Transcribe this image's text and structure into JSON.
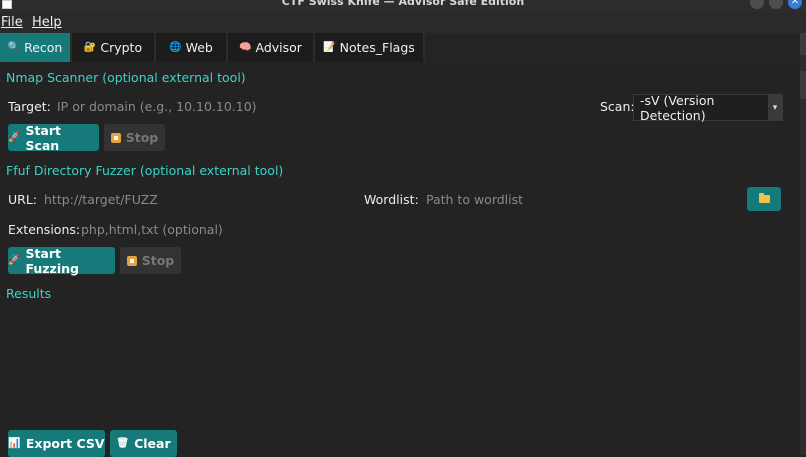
{
  "window": {
    "title": "CTF Swiss Knife — Advisor Safe Edition",
    "close_glyph": "✕"
  },
  "menu": [
    {
      "label": "File"
    },
    {
      "label": "Help"
    }
  ],
  "tabs": [
    {
      "label": "Recon",
      "icon": "🔍",
      "icon_name": "magnifier-icon",
      "active": true
    },
    {
      "label": "Crypto",
      "icon": "🔐",
      "icon_name": "lock-icon"
    },
    {
      "label": "Web",
      "icon": "🌐",
      "icon_name": "globe-icon"
    },
    {
      "label": "Advisor",
      "icon": "🧠",
      "icon_name": "brain-icon"
    },
    {
      "label": "Notes_Flags",
      "icon": "📝",
      "icon_name": "memo-icon"
    }
  ],
  "nmap": {
    "heading": "Nmap Scanner (optional external tool)",
    "target_label": "Target:",
    "target_placeholder": "IP or domain (e.g., 10.10.10.10)",
    "scan_label": "Scan:",
    "scan_value": "-sV (Version Detection)",
    "start_label": "Start Scan",
    "stop_label": "Stop"
  },
  "ffuf": {
    "heading": "Ffuf Directory Fuzzer (optional external tool)",
    "url_label": "URL:",
    "url_placeholder": "http://target/FUZZ",
    "wordlist_label": "Wordlist:",
    "wordlist_placeholder": "Path to wordlist",
    "extensions_label": "Extensions:",
    "extensions_placeholder": "php,html,txt (optional)",
    "start_label": "Start Fuzzing",
    "stop_label": "Stop"
  },
  "results": {
    "heading": "Results",
    "export_label": "Export CSV",
    "clear_label": "Clear"
  },
  "icons": {
    "rocket": "🚀",
    "chart": "📊",
    "trash": "🗑"
  },
  "colors": {
    "accent": "#167a7a",
    "heading": "#3fd2c7",
    "background": "#232323"
  }
}
